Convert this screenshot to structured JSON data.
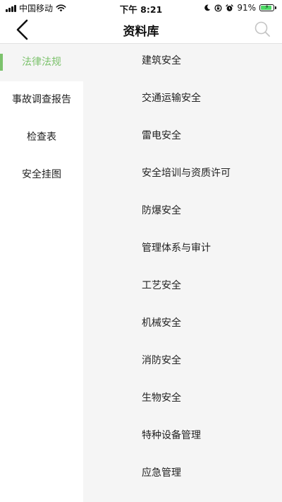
{
  "status_bar": {
    "carrier": "中国移动",
    "time": "下午 8:21",
    "battery_percent_text": "91%",
    "battery_level": 0.91,
    "icons": [
      "signal-icon",
      "wifi-icon",
      "moon-icon",
      "location-lock-icon",
      "alarm-icon",
      "battery-icon"
    ]
  },
  "nav": {
    "title": "资料库",
    "back_icon": "chevron-left-icon",
    "search_icon": "search-icon"
  },
  "sidebar": {
    "items": [
      {
        "label": "法律法规",
        "active": true
      },
      {
        "label": "事故调查报告",
        "active": false
      },
      {
        "label": "检查表",
        "active": false
      },
      {
        "label": "安全挂图",
        "active": false
      }
    ]
  },
  "categories": [
    "建筑安全",
    "交通运输安全",
    "雷电安全",
    "安全培训与资质许可",
    "防爆安全",
    "管理体系与审计",
    "工艺安全",
    "机械安全",
    "消防安全",
    "生物安全",
    "特种设备管理",
    "应急管理"
  ],
  "colors": {
    "accent": "#7cc26c",
    "panel_background": "#f5f5f5",
    "battery": "#4cd964"
  }
}
